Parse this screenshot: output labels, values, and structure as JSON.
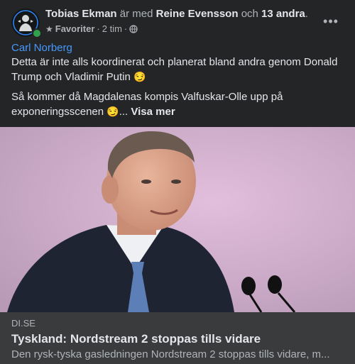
{
  "post": {
    "author": "Tobias Ekman",
    "with_word": "är med",
    "tagged_person": "Reine Evensson",
    "and_word": "och",
    "others_count": "13 andra",
    "period": ".",
    "audience": "Favoriter",
    "separator": "·",
    "time": "2 tim",
    "more_options": "•••",
    "mention": "Carl Norberg",
    "paragraph1": "Detta är inte alls koordinerat och planerat bland andra genom Donald Trump och Vladimir Putin",
    "paragraph2": "Så kommer då Magdalenas kompis Valfuskar-Olle upp på exponeringsscenen",
    "ellipsis": "...",
    "see_more": "Visa mer",
    "emoji": "😏"
  },
  "link_preview": {
    "domain": "DI.SE",
    "title": "Tyskland: Nordstream 2 stoppas tills vidare",
    "description": "Den rysk-tyska gasledningen Nordstream 2 stoppas tills vidare, m..."
  },
  "icons": {
    "audience_icon": "star-icon",
    "privacy_icon": "globe-icon",
    "online_indicator": "online-dot-icon"
  },
  "colors": {
    "background": "#242526",
    "link_blue": "#4599ff",
    "online_green": "#31a24c",
    "preview_bg": "#3a3b3c",
    "secondary_text": "#b0b3b8"
  }
}
